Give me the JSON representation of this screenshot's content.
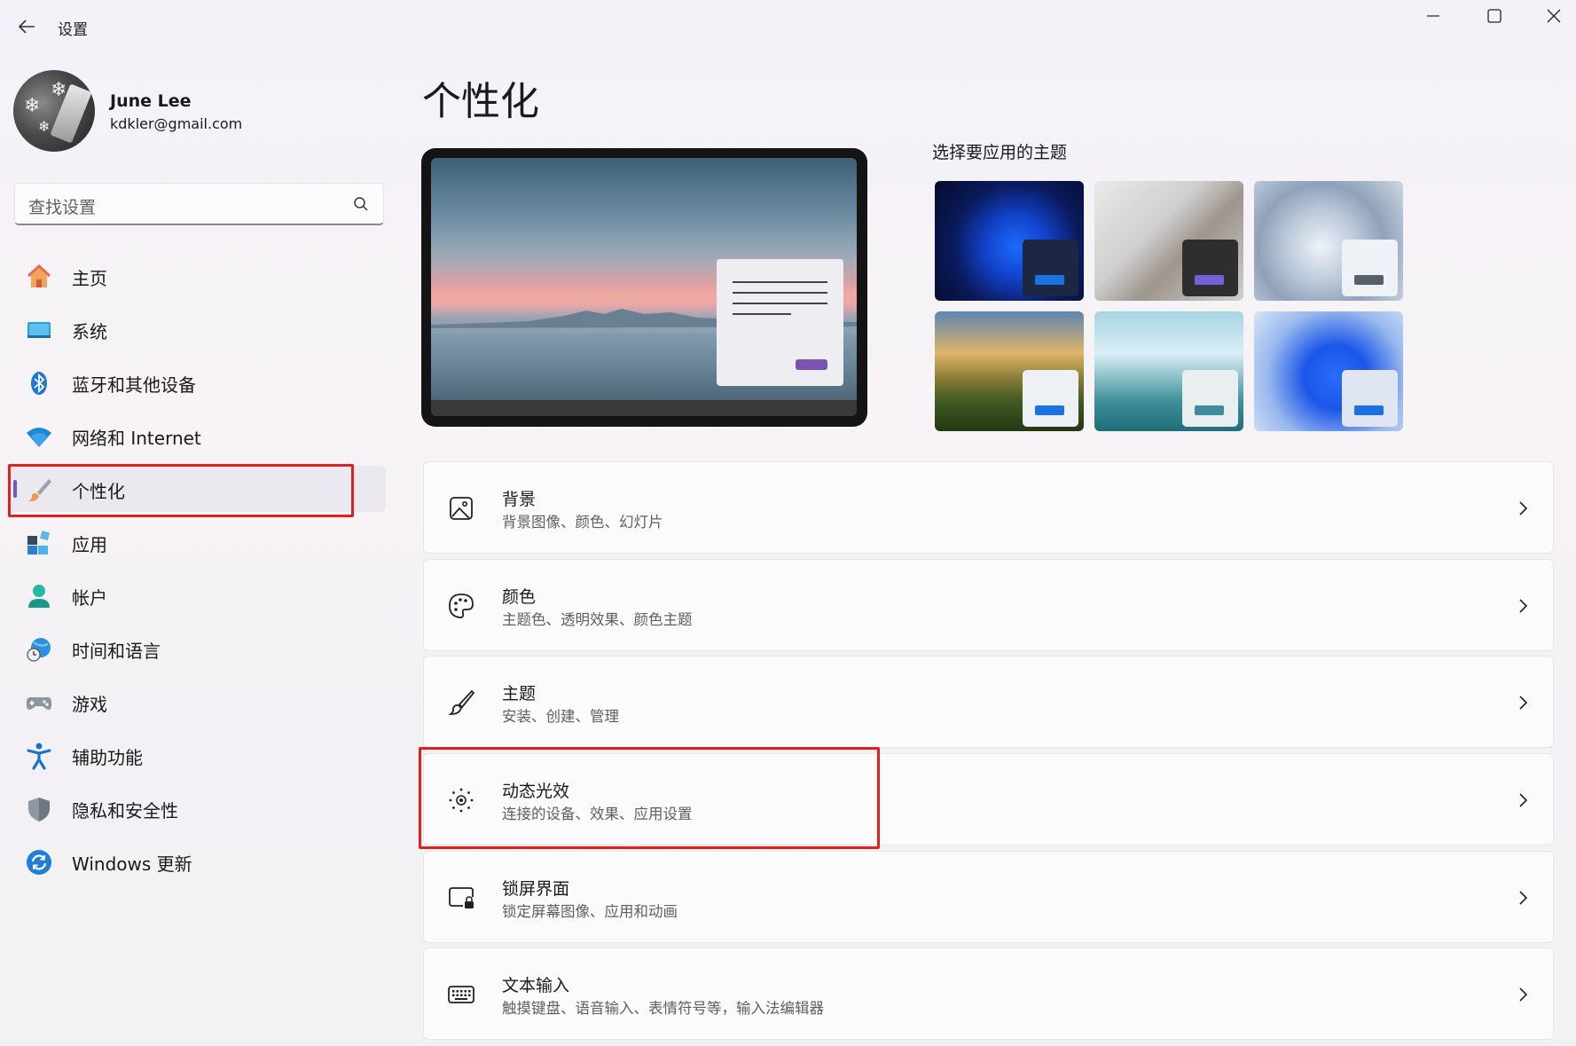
{
  "window": {
    "title": "设置"
  },
  "profile": {
    "name": "June Lee",
    "email": "kdkler@gmail.com"
  },
  "search": {
    "placeholder": "查找设置"
  },
  "sidebar": {
    "items": [
      {
        "label": "主页",
        "icon": "home-icon"
      },
      {
        "label": "系统",
        "icon": "system-icon"
      },
      {
        "label": "蓝牙和其他设备",
        "icon": "bluetooth-icon"
      },
      {
        "label": "网络和 Internet",
        "icon": "wifi-icon"
      },
      {
        "label": "个性化",
        "icon": "brush-icon",
        "active": true
      },
      {
        "label": "应用",
        "icon": "apps-icon"
      },
      {
        "label": "帐户",
        "icon": "account-icon"
      },
      {
        "label": "时间和语言",
        "icon": "time-language-icon"
      },
      {
        "label": "游戏",
        "icon": "gamepad-icon"
      },
      {
        "label": "辅助功能",
        "icon": "accessibility-icon"
      },
      {
        "label": "隐私和安全性",
        "icon": "shield-icon"
      },
      {
        "label": "Windows 更新",
        "icon": "update-icon"
      }
    ]
  },
  "main": {
    "page_title": "个性化",
    "themes_title": "选择要应用的主题",
    "cards": [
      {
        "title": "背景",
        "subtitle": "背景图像、颜色、幻灯片",
        "icon": "image-icon"
      },
      {
        "title": "颜色",
        "subtitle": "主题色、透明效果、颜色主题",
        "icon": "palette-icon"
      },
      {
        "title": "主题",
        "subtitle": "安装、创建、管理",
        "icon": "brush-icon"
      },
      {
        "title": "动态光效",
        "subtitle": "连接的设备、效果、应用设置",
        "icon": "dynamic-lighting-icon"
      },
      {
        "title": "锁屏界面",
        "subtitle": "锁定屏幕图像、应用和动画",
        "icon": "lock-screen-icon"
      },
      {
        "title": "文本输入",
        "subtitle": "触摸键盘、语音输入、表情符号等，输入法编辑器",
        "icon": "keyboard-icon"
      }
    ]
  },
  "colors": {
    "accent": "#6a5fb3",
    "highlight_box": "#e0201c",
    "preview_button": "#7a52b0"
  }
}
